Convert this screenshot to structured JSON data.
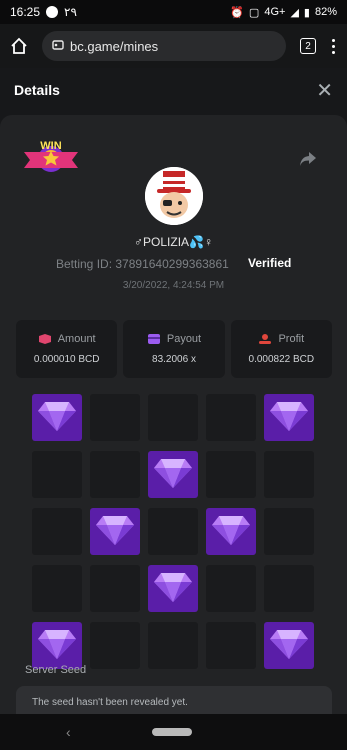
{
  "status_bar": {
    "time": "16:25",
    "extra": "٢٩",
    "network": "4G+",
    "battery": "82%"
  },
  "browser": {
    "url": "bc.game/mines",
    "tab_count": "2"
  },
  "header": {
    "title": "Details"
  },
  "bet": {
    "win_badge": "WIN",
    "username": "♂POLIZIA💦♀",
    "betting_id_label": "Betting ID:",
    "betting_id": "37891640299363861",
    "verified": "Verified",
    "datetime": "3/20/2022, 4:24:54 PM"
  },
  "stats": [
    {
      "label": "Amount",
      "value": "0.000010 BCD",
      "icon": "amount-icon",
      "color": "#e0466e"
    },
    {
      "label": "Payout",
      "value": "83.2006 x",
      "icon": "payout-icon",
      "color": "#9b5cf0"
    },
    {
      "label": "Profit",
      "value": "0.000822 BCD",
      "icon": "profit-icon",
      "color": "#e0463c"
    }
  ],
  "grid": {
    "rows": 5,
    "cols": 5,
    "gems": [
      [
        0,
        0
      ],
      [
        0,
        4
      ],
      [
        1,
        2
      ],
      [
        2,
        1
      ],
      [
        2,
        3
      ],
      [
        3,
        2
      ],
      [
        4,
        0
      ],
      [
        4,
        4
      ]
    ]
  },
  "seed": {
    "label": "Server Seed",
    "text": "The seed hasn't been revealed yet."
  }
}
